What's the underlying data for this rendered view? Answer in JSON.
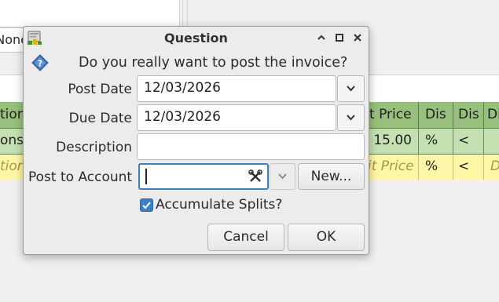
{
  "background": {
    "field_value": "None",
    "register": {
      "header": [
        "tion",
        "t Price",
        "Dis",
        "Dis",
        "Di"
      ],
      "row1": [
        "ons",
        "15.00",
        "%",
        "<",
        ""
      ],
      "row2": [
        "tion",
        "it Price",
        "%",
        "<",
        "D"
      ]
    },
    "colors": {
      "header_bg": "#97c07c",
      "row1_bg": "#c5e1b2",
      "row2_bg": "#fff7a8"
    }
  },
  "dialog": {
    "title": "Question",
    "question": "Do you really want to post the invoice?",
    "post_date_label": "Post Date",
    "post_date_value": "12/03/2026",
    "due_date_label": "Due Date",
    "due_date_value": "12/03/2026",
    "description_label": "Description",
    "description_value": "",
    "account_label": "Post to Account",
    "account_value": "",
    "new_button": "New...",
    "accumulate_label": "Accumulate Splits?",
    "accumulate_checked": true,
    "cancel_button": "Cancel",
    "ok_button": "OK",
    "icons": {
      "app": "gnucash-app-icon",
      "question": "question-icon",
      "minimize": "minimize-icon",
      "maximize": "maximize-icon",
      "close": "close-icon",
      "account_tools": "tools-icon"
    },
    "accent": "#3d7ec4"
  }
}
